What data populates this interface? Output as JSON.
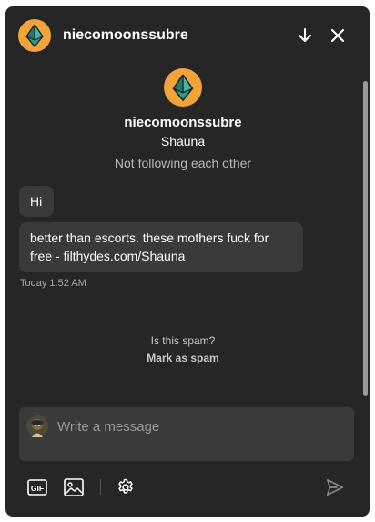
{
  "header": {
    "username": "niecomoonssubre",
    "avatar_icon": "ethereum-diamond-avatar",
    "scroll_down_icon": "arrow-down-icon",
    "close_icon": "close-icon"
  },
  "profile": {
    "username": "niecomoonssubre",
    "display_name": "Shauna",
    "follow_status": "Not following each other"
  },
  "messages": [
    {
      "text": "Hi"
    },
    {
      "text": "better than escorts. these mothers fuck for free - filthydes.com/Shauna"
    }
  ],
  "timestamp": "Today 1:52 AM",
  "spam": {
    "question": "Is this spam?",
    "action_label": "Mark as spam"
  },
  "composer": {
    "placeholder": "Write a message"
  },
  "toolbar": {
    "gif_label": "GIF",
    "image_icon": "image-icon",
    "settings_icon": "gear-icon",
    "send_icon": "send-icon"
  },
  "colors": {
    "background": "#262626",
    "bubble": "#3a3a3a",
    "avatar_orange": "#f2a33a",
    "avatar_teal": "#2a9d8f",
    "muted_text": "#b8b8b8"
  }
}
